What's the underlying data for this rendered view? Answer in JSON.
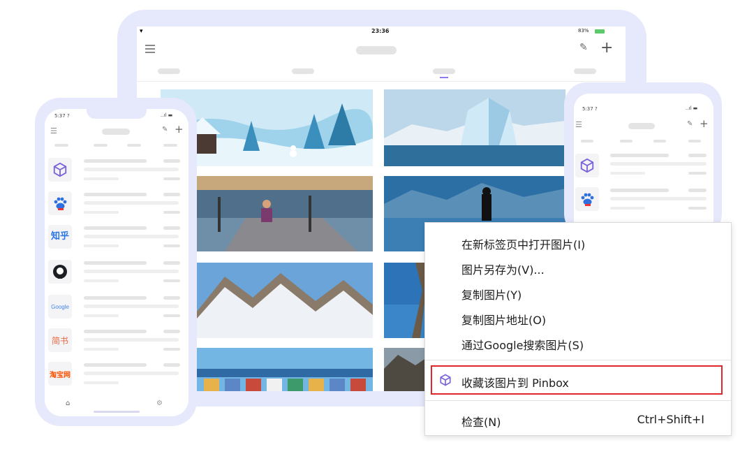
{
  "tablet": {
    "status_time": "23:36",
    "status_battery": "83%"
  },
  "phone_left": {
    "status_time": "5:37 ?",
    "apps": [
      {
        "icon": "pinbox-icon"
      },
      {
        "icon": "baidu-icon"
      },
      {
        "icon": "zhihu-icon",
        "text": "知乎"
      },
      {
        "icon": "github-icon"
      },
      {
        "icon": "google-icon",
        "text": "Google"
      },
      {
        "icon": "jianshu-icon",
        "text": "简书"
      },
      {
        "icon": "taobao-icon",
        "text": "淘宝网"
      }
    ]
  },
  "phone_right": {
    "status_time": "5:37 ?"
  },
  "context_menu": {
    "items": [
      {
        "label": "在新标签页中打开图片(I)"
      },
      {
        "label": "图片另存为(V)..."
      },
      {
        "label": "复制图片(Y)"
      },
      {
        "label": "复制图片地址(O)"
      },
      {
        "label": "通过Google搜索图片(S)"
      }
    ],
    "pinbox": {
      "label": "收藏该图片到 Pinbox",
      "icon": "pinbox-icon"
    },
    "inspect": {
      "label": "检查(N)",
      "shortcut": "Ctrl+Shift+I"
    },
    "highlight_color": "#e0262b"
  },
  "colors": {
    "device_frame": "#e6e8fb",
    "accent": "#8a7cf0",
    "placeholder_bar": "#e4e4e4"
  }
}
